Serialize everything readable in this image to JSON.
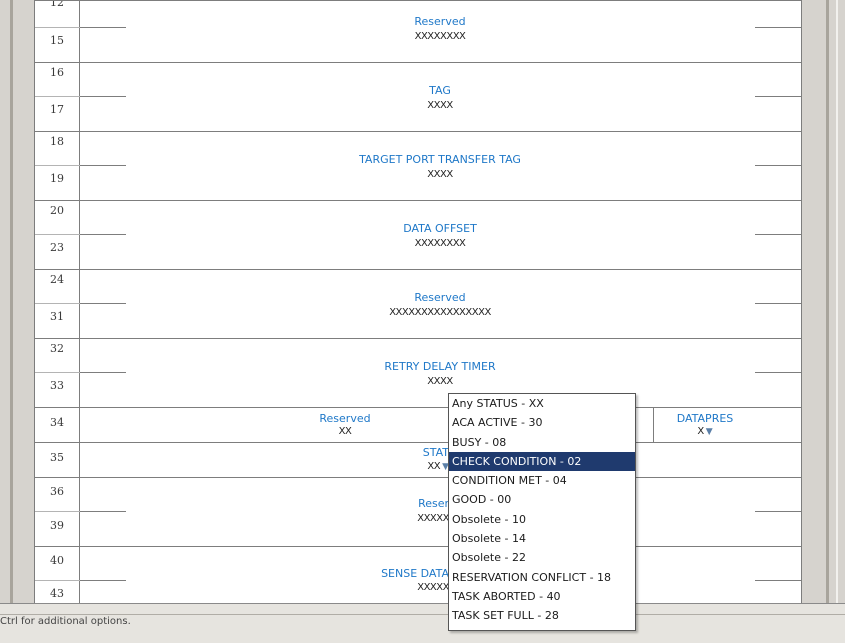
{
  "rows": {
    "r12": "12",
    "r15": "15",
    "r16": "16",
    "r17": "17",
    "r18": "18",
    "r19": "19",
    "r20": "20",
    "r23": "23",
    "r24": "24",
    "r31": "31",
    "r32": "32",
    "r33": "33",
    "r34": "34",
    "r35": "35",
    "r36": "36",
    "r39": "39",
    "r40": "40",
    "r43": "43"
  },
  "fields": {
    "reserved1": {
      "name": "Reserved",
      "value": "XXXXXXXX"
    },
    "tag": {
      "name": "TAG",
      "value": "XXXX"
    },
    "target_port_transfer_tag": {
      "name": "TARGET PORT TRANSFER TAG",
      "value": "XXXX"
    },
    "data_offset": {
      "name": "DATA OFFSET",
      "value": "XXXXXXXX"
    },
    "reserved2": {
      "name": "Reserved",
      "value": "XXXXXXXXXXXXXXXX"
    },
    "retry_delay_timer": {
      "name": "RETRY DELAY TIMER",
      "value": "XXXX"
    },
    "reserved3": {
      "name": "Reserved",
      "value": "XX"
    },
    "datapres": {
      "name": "DATAPRES",
      "value": "X"
    },
    "status": {
      "name": "STAT",
      "value": "XX"
    },
    "reserved4": {
      "name": "Reser",
      "value": "XXXXX"
    },
    "sense_data": {
      "name": "SENSE DATA",
      "value": "XXXXX"
    }
  },
  "status_bar": {
    "hint": "Ctrl for additional options."
  },
  "dropdown": {
    "selected_index": 3,
    "options": [
      "Any STATUS - XX",
      "ACA ACTIVE - 30",
      "BUSY - 08",
      "CHECK CONDITION - 02",
      "CONDITION MET - 04",
      "GOOD - 00",
      "Obsolete - 10",
      "Obsolete - 14",
      "Obsolete - 22",
      "RESERVATION CONFLICT - 18",
      "TASK ABORTED - 40",
      "TASK SET FULL - 28"
    ]
  },
  "colors": {
    "field_name": "#1f78c8",
    "selected_bg": "#1f3a6e",
    "frame": "#d6d3ce"
  },
  "icons": {
    "dropdown_arrow": "dropdown-arrow-icon"
  }
}
